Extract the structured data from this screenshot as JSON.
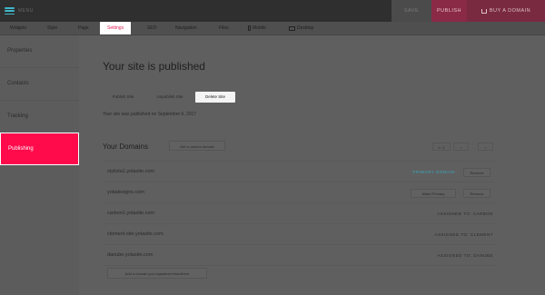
{
  "topbar": {
    "menu_label": "MENU",
    "save_label": "SAVE",
    "publish_label": "PUBLISH",
    "domain_label": "BUY A DOMAIN"
  },
  "tabs": [
    {
      "label": "Widgets"
    },
    {
      "label": "Style"
    },
    {
      "label": "Page"
    },
    {
      "label": "Settings",
      "active": true
    },
    {
      "label": "SEO"
    },
    {
      "label": "Navigation"
    },
    {
      "label": "Files"
    },
    {
      "label": "Mobile"
    },
    {
      "label": "Desktop"
    }
  ],
  "sidebar": {
    "items": [
      {
        "label": "Properties"
      },
      {
        "label": "Contacts"
      },
      {
        "label": "Tracking"
      },
      {
        "label": "Publishing",
        "active": true
      }
    ]
  },
  "main": {
    "heading": "Your site is published",
    "sub_buttons": {
      "publish": "Publish Site",
      "unpublish": "Unpublish Site",
      "delete": "Delete Site"
    },
    "published_note": "Your site was published on September 6, 2017",
    "domains": {
      "title": "Your Domains",
      "custom_domain_button": "Get a custom domain",
      "pager_label": "1 / 1",
      "prev_symbol": "‹",
      "next_symbol": "›",
      "rows": [
        {
          "name": "stylista1.yolasite.com",
          "status": "PRIMARY DOMAIN",
          "action": "Remove"
        },
        {
          "name": "yoladesigns.com",
          "status": "",
          "primary_action": "Make Primary",
          "action": "Remove"
        },
        {
          "name": "carbon1.yolasite.com",
          "status": "ASSIGNED TO: CARBON"
        },
        {
          "name": "clement-site.yolasite.com",
          "status": "ASSIGNED TO: CLEMENT"
        },
        {
          "name": "danube.yolasite.com",
          "status": "ASSIGNED TO: DANUBE"
        }
      ],
      "add_button": "Add a domain you registered elsewhere"
    }
  },
  "colors": {
    "accent": "#ff0a4b",
    "primary_status": "#3aa6be"
  }
}
